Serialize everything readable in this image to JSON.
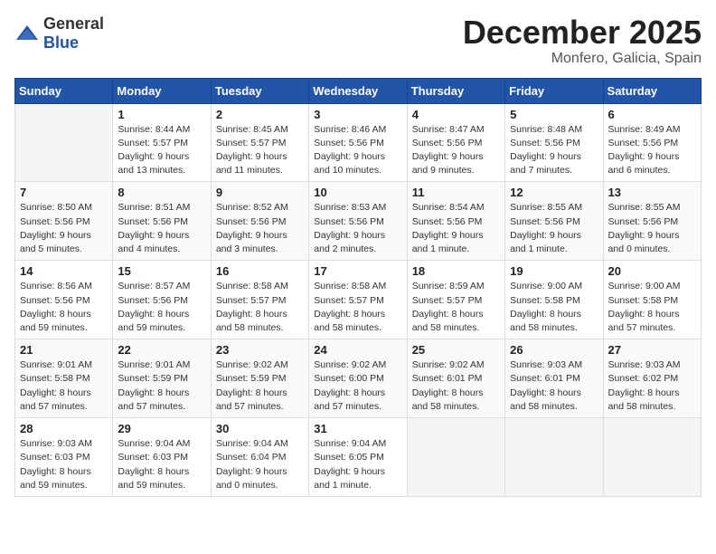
{
  "header": {
    "logo_general": "General",
    "logo_blue": "Blue",
    "month": "December 2025",
    "location": "Monfero, Galicia, Spain"
  },
  "days_of_week": [
    "Sunday",
    "Monday",
    "Tuesday",
    "Wednesday",
    "Thursday",
    "Friday",
    "Saturday"
  ],
  "weeks": [
    [
      {
        "day": "",
        "sunrise": "",
        "sunset": "",
        "daylight": ""
      },
      {
        "day": "1",
        "sunrise": "Sunrise: 8:44 AM",
        "sunset": "Sunset: 5:57 PM",
        "daylight": "Daylight: 9 hours and 13 minutes."
      },
      {
        "day": "2",
        "sunrise": "Sunrise: 8:45 AM",
        "sunset": "Sunset: 5:57 PM",
        "daylight": "Daylight: 9 hours and 11 minutes."
      },
      {
        "day": "3",
        "sunrise": "Sunrise: 8:46 AM",
        "sunset": "Sunset: 5:56 PM",
        "daylight": "Daylight: 9 hours and 10 minutes."
      },
      {
        "day": "4",
        "sunrise": "Sunrise: 8:47 AM",
        "sunset": "Sunset: 5:56 PM",
        "daylight": "Daylight: 9 hours and 9 minutes."
      },
      {
        "day": "5",
        "sunrise": "Sunrise: 8:48 AM",
        "sunset": "Sunset: 5:56 PM",
        "daylight": "Daylight: 9 hours and 7 minutes."
      },
      {
        "day": "6",
        "sunrise": "Sunrise: 8:49 AM",
        "sunset": "Sunset: 5:56 PM",
        "daylight": "Daylight: 9 hours and 6 minutes."
      }
    ],
    [
      {
        "day": "7",
        "sunrise": "Sunrise: 8:50 AM",
        "sunset": "Sunset: 5:56 PM",
        "daylight": "Daylight: 9 hours and 5 minutes."
      },
      {
        "day": "8",
        "sunrise": "Sunrise: 8:51 AM",
        "sunset": "Sunset: 5:56 PM",
        "daylight": "Daylight: 9 hours and 4 minutes."
      },
      {
        "day": "9",
        "sunrise": "Sunrise: 8:52 AM",
        "sunset": "Sunset: 5:56 PM",
        "daylight": "Daylight: 9 hours and 3 minutes."
      },
      {
        "day": "10",
        "sunrise": "Sunrise: 8:53 AM",
        "sunset": "Sunset: 5:56 PM",
        "daylight": "Daylight: 9 hours and 2 minutes."
      },
      {
        "day": "11",
        "sunrise": "Sunrise: 8:54 AM",
        "sunset": "Sunset: 5:56 PM",
        "daylight": "Daylight: 9 hours and 1 minute."
      },
      {
        "day": "12",
        "sunrise": "Sunrise: 8:55 AM",
        "sunset": "Sunset: 5:56 PM",
        "daylight": "Daylight: 9 hours and 1 minute."
      },
      {
        "day": "13",
        "sunrise": "Sunrise: 8:55 AM",
        "sunset": "Sunset: 5:56 PM",
        "daylight": "Daylight: 9 hours and 0 minutes."
      }
    ],
    [
      {
        "day": "14",
        "sunrise": "Sunrise: 8:56 AM",
        "sunset": "Sunset: 5:56 PM",
        "daylight": "Daylight: 8 hours and 59 minutes."
      },
      {
        "day": "15",
        "sunrise": "Sunrise: 8:57 AM",
        "sunset": "Sunset: 5:56 PM",
        "daylight": "Daylight: 8 hours and 59 minutes."
      },
      {
        "day": "16",
        "sunrise": "Sunrise: 8:58 AM",
        "sunset": "Sunset: 5:57 PM",
        "daylight": "Daylight: 8 hours and 58 minutes."
      },
      {
        "day": "17",
        "sunrise": "Sunrise: 8:58 AM",
        "sunset": "Sunset: 5:57 PM",
        "daylight": "Daylight: 8 hours and 58 minutes."
      },
      {
        "day": "18",
        "sunrise": "Sunrise: 8:59 AM",
        "sunset": "Sunset: 5:57 PM",
        "daylight": "Daylight: 8 hours and 58 minutes."
      },
      {
        "day": "19",
        "sunrise": "Sunrise: 9:00 AM",
        "sunset": "Sunset: 5:58 PM",
        "daylight": "Daylight: 8 hours and 58 minutes."
      },
      {
        "day": "20",
        "sunrise": "Sunrise: 9:00 AM",
        "sunset": "Sunset: 5:58 PM",
        "daylight": "Daylight: 8 hours and 57 minutes."
      }
    ],
    [
      {
        "day": "21",
        "sunrise": "Sunrise: 9:01 AM",
        "sunset": "Sunset: 5:58 PM",
        "daylight": "Daylight: 8 hours and 57 minutes."
      },
      {
        "day": "22",
        "sunrise": "Sunrise: 9:01 AM",
        "sunset": "Sunset: 5:59 PM",
        "daylight": "Daylight: 8 hours and 57 minutes."
      },
      {
        "day": "23",
        "sunrise": "Sunrise: 9:02 AM",
        "sunset": "Sunset: 5:59 PM",
        "daylight": "Daylight: 8 hours and 57 minutes."
      },
      {
        "day": "24",
        "sunrise": "Sunrise: 9:02 AM",
        "sunset": "Sunset: 6:00 PM",
        "daylight": "Daylight: 8 hours and 57 minutes."
      },
      {
        "day": "25",
        "sunrise": "Sunrise: 9:02 AM",
        "sunset": "Sunset: 6:01 PM",
        "daylight": "Daylight: 8 hours and 58 minutes."
      },
      {
        "day": "26",
        "sunrise": "Sunrise: 9:03 AM",
        "sunset": "Sunset: 6:01 PM",
        "daylight": "Daylight: 8 hours and 58 minutes."
      },
      {
        "day": "27",
        "sunrise": "Sunrise: 9:03 AM",
        "sunset": "Sunset: 6:02 PM",
        "daylight": "Daylight: 8 hours and 58 minutes."
      }
    ],
    [
      {
        "day": "28",
        "sunrise": "Sunrise: 9:03 AM",
        "sunset": "Sunset: 6:03 PM",
        "daylight": "Daylight: 8 hours and 59 minutes."
      },
      {
        "day": "29",
        "sunrise": "Sunrise: 9:04 AM",
        "sunset": "Sunset: 6:03 PM",
        "daylight": "Daylight: 8 hours and 59 minutes."
      },
      {
        "day": "30",
        "sunrise": "Sunrise: 9:04 AM",
        "sunset": "Sunset: 6:04 PM",
        "daylight": "Daylight: 9 hours and 0 minutes."
      },
      {
        "day": "31",
        "sunrise": "Sunrise: 9:04 AM",
        "sunset": "Sunset: 6:05 PM",
        "daylight": "Daylight: 9 hours and 1 minute."
      },
      {
        "day": "",
        "sunrise": "",
        "sunset": "",
        "daylight": ""
      },
      {
        "day": "",
        "sunrise": "",
        "sunset": "",
        "daylight": ""
      },
      {
        "day": "",
        "sunrise": "",
        "sunset": "",
        "daylight": ""
      }
    ]
  ]
}
